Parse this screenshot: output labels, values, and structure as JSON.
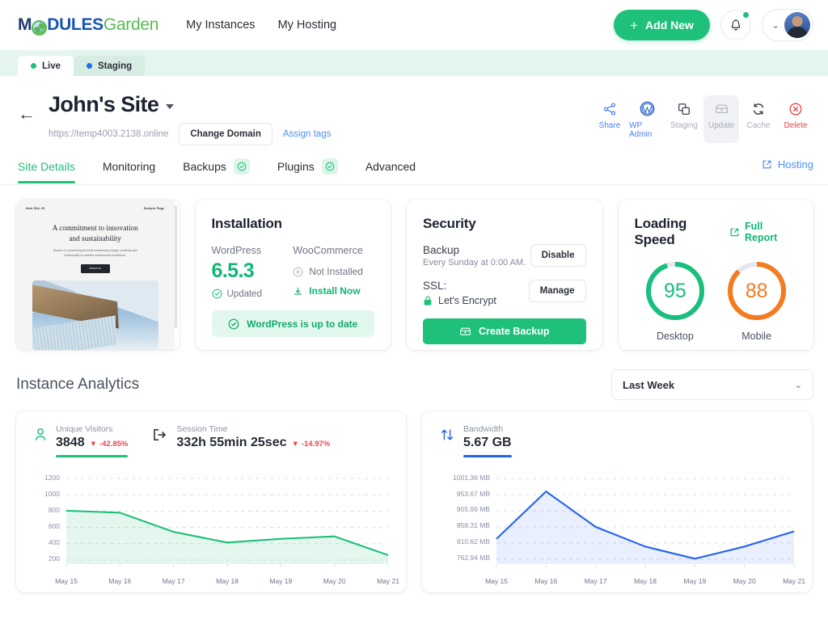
{
  "header": {
    "logo": {
      "part1": "M",
      "part2": "DULES",
      "part3": "Garden",
      "icon": "globe-icon"
    },
    "nav": [
      {
        "label": "My Instances"
      },
      {
        "label": "My Hosting"
      }
    ],
    "add_new": "Add New",
    "notifications_icon": "bell-icon",
    "account_icon": "avatar"
  },
  "env_tabs": [
    {
      "label": "Live",
      "active": true,
      "dot": "#1fc07a"
    },
    {
      "label": "Staging",
      "active": false,
      "dot": "#1a73e8"
    }
  ],
  "site": {
    "back_icon": "back-arrow-icon",
    "title": "John's Site",
    "url": "https://temp4003.2138.online",
    "change_domain": "Change Domain",
    "assign_tags": "Assign tags",
    "actions": [
      {
        "label": "Share",
        "icon": "share-icon",
        "state": "blue"
      },
      {
        "label": "WP Admin",
        "icon": "wordpress-icon",
        "state": "blue"
      },
      {
        "label": "Staging",
        "icon": "copy-icon",
        "state": "grey"
      },
      {
        "label": "Update",
        "icon": "update-box-icon",
        "state": "grey",
        "selected": true
      },
      {
        "label": "Cache",
        "icon": "refresh-icon",
        "state": "grey"
      },
      {
        "label": "Delete",
        "icon": "delete-circle-icon",
        "state": "red"
      }
    ]
  },
  "section_tabs": [
    {
      "label": "Site Details",
      "active": true,
      "badge": false
    },
    {
      "label": "Monitoring",
      "active": false,
      "badge": false
    },
    {
      "label": "Backups",
      "active": false,
      "badge": true
    },
    {
      "label": "Plugins",
      "active": false,
      "badge": true
    },
    {
      "label": "Advanced",
      "active": false,
      "badge": false
    }
  ],
  "hosting_link": "Hosting",
  "preview": {
    "site_name": "New Site #5",
    "menu": "Sample Page",
    "heading_l1": "A commitment to innovation",
    "heading_l2": "and sustainability",
    "paragraph_l1": "Études is a pioneering firm that seamlessly merges creativity and",
    "paragraph_l2": "functionality to redefine architectural excellence.",
    "button": "About us"
  },
  "installation": {
    "title": "Installation",
    "wordpress_label": "WordPress",
    "wordpress_version": "6.5.3",
    "wordpress_status": "Updated",
    "woocommerce_label": "WooCommerce",
    "woocommerce_status": "Not Installed",
    "install_now": "Install Now",
    "banner": "WordPress is up to date"
  },
  "security": {
    "title": "Security",
    "backup_label": "Backup",
    "backup_schedule": "Every Sunday at 0:00 AM.",
    "backup_button": "Disable",
    "ssl_label": "SSL:",
    "ssl_value": "Let's Encrypt",
    "ssl_button": "Manage",
    "create_backup": "Create Backup"
  },
  "loading_speed": {
    "title": "Loading Speed",
    "full_report": "Full Report",
    "gauges": [
      {
        "value": 95,
        "caption": "Desktop",
        "color": "#18bf7d"
      },
      {
        "value": 88,
        "caption": "Mobile",
        "color": "#f47b20"
      }
    ]
  },
  "analytics": {
    "title": "Instance Analytics",
    "range": "Last Week",
    "metrics": [
      {
        "label": "Unique Visitors",
        "value": "3848",
        "delta": "-42.85%",
        "icon": "user-icon",
        "color": "#1fc07a"
      },
      {
        "label": "Session Time",
        "value": "332h 55min 25sec",
        "delta": "-14.97%",
        "icon": "exit-icon",
        "color": "#252a35"
      },
      {
        "label": "Bandwidth",
        "value": "5.67 GB",
        "delta": "",
        "icon": "transfer-icon",
        "color": "#2563eb"
      }
    ]
  },
  "chart_data": [
    {
      "type": "area",
      "title": "Unique Visitors",
      "x": [
        "May 15",
        "May 16",
        "May 17",
        "May 18",
        "May 19",
        "May 20",
        "May 21"
      ],
      "values": [
        805,
        780,
        545,
        415,
        460,
        490,
        260
      ],
      "ytick_labels": [
        "200",
        "400",
        "600",
        "800",
        "1000",
        "1200"
      ],
      "ytick_values": [
        200,
        400,
        600,
        800,
        1000,
        1200
      ],
      "ylim": [
        150,
        1260
      ],
      "xlabel": "",
      "ylabel": "",
      "line_color": "#1fc07a",
      "fill_color": "rgba(31,192,122,0.12)",
      "grid": true,
      "legend": "none"
    },
    {
      "type": "area",
      "title": "Bandwidth",
      "x": [
        "May 15",
        "May 16",
        "May 17",
        "May 18",
        "May 19",
        "May 20",
        "May 21"
      ],
      "values": [
        823,
        963,
        858,
        800,
        764,
        800,
        845
      ],
      "ytick_labels": [
        "762.94 MB",
        "810.62 MB",
        "858.31 MB",
        "905.99 MB",
        "953.67 MB",
        "1001.36 MB"
      ],
      "ytick_values": [
        762.94,
        810.62,
        858.31,
        905.99,
        953.67,
        1001.36
      ],
      "ylim": [
        748,
        1016
      ],
      "xlabel": "",
      "ylabel": "",
      "line_color": "#2563eb",
      "fill_color": "rgba(37,99,235,0.10)",
      "grid": true,
      "legend": "none"
    }
  ]
}
